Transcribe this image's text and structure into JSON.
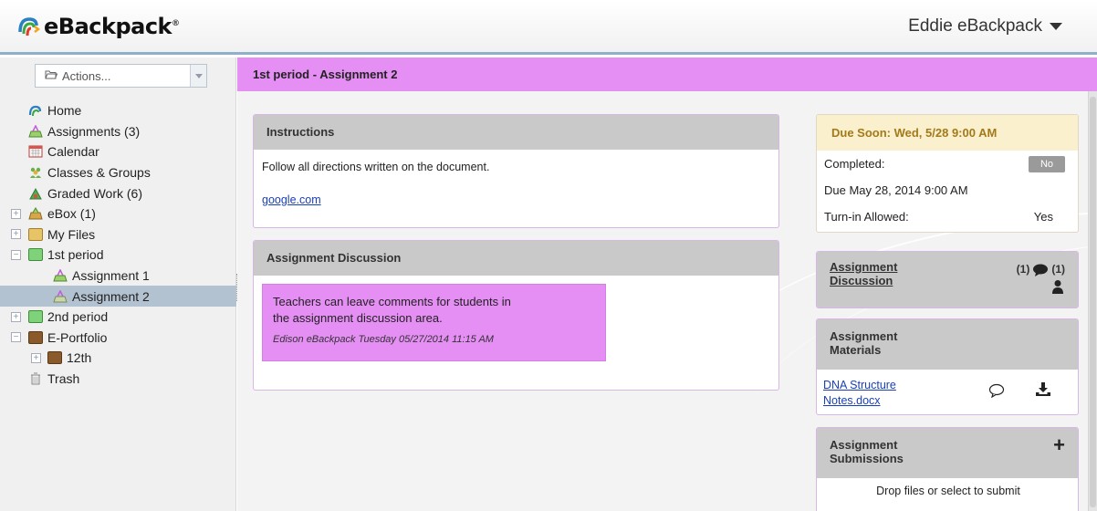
{
  "header": {
    "logo_text": "eBackpack",
    "logo_reg": "®",
    "user_name": "Eddie eBackpack"
  },
  "sidebar": {
    "actions_label": "Actions...",
    "items": [
      {
        "label": "Home",
        "icon": "home-icon"
      },
      {
        "label": "Assignments (3)",
        "icon": "assignments-icon"
      },
      {
        "label": "Calendar",
        "icon": "calendar-icon"
      },
      {
        "label": "Classes & Groups",
        "icon": "groups-icon"
      },
      {
        "label": "Graded Work (6)",
        "icon": "graded-icon"
      },
      {
        "label": "eBox (1)",
        "icon": "ebox-icon"
      },
      {
        "label": "My Files",
        "icon": "folder-icon"
      },
      {
        "label": "1st period",
        "icon": "folder-icon"
      },
      {
        "label": "Assignment 1",
        "icon": "assignment-icon"
      },
      {
        "label": "Assignment 2",
        "icon": "assignment-icon"
      },
      {
        "label": "2nd period",
        "icon": "folder-icon"
      },
      {
        "label": "E-Portfolio",
        "icon": "folder-icon"
      },
      {
        "label": "12th",
        "icon": "folder-icon"
      },
      {
        "label": "Trash",
        "icon": "trash-icon"
      }
    ],
    "expander_plus": "+",
    "expander_minus": "−"
  },
  "page": {
    "title": "1st period - Assignment 2"
  },
  "instructions": {
    "heading": "Instructions",
    "text": "Follow all directions written on the document.",
    "link": "google.com"
  },
  "discussion": {
    "heading": "Assignment Discussion",
    "comment_line1": "Teachers can leave comments for students in",
    "comment_line2": "the assignment discussion area.",
    "comment_meta": "Edison eBackpack Tuesday 05/27/2014 11:15 AM"
  },
  "due": {
    "heading": "Due Soon: Wed, 5/28 9:00 AM",
    "completed_label": "Completed:",
    "completed_value": "No",
    "due_date": "Due May 28, 2014 9:00 AM",
    "turnin_label": "Turn-in Allowed:",
    "turnin_value": "Yes"
  },
  "right_discussion": {
    "line1": "Assignment",
    "line2": "Discussion",
    "comment_count": "(1)",
    "user_count": "(1)"
  },
  "materials": {
    "line1": "Assignment",
    "line2": "Materials",
    "file_line1": "DNA Structure",
    "file_line2": "Notes.docx"
  },
  "submissions": {
    "line1": "Assignment",
    "line2": "Submissions",
    "drop_text": "Drop files or select to submit"
  },
  "colors": {
    "accent_purple": "#e58ff4",
    "header_border": "#8fb0c9",
    "due_bg": "#fbf0cd",
    "due_text": "#a27a1a",
    "link_blue": "#1a3fb5"
  }
}
